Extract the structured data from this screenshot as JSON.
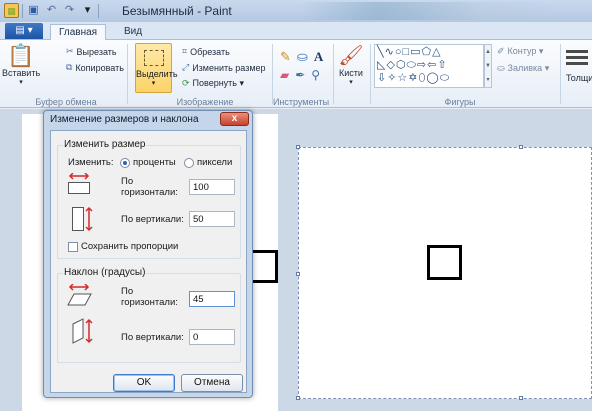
{
  "titlebar": {
    "title": "Безымянный - Paint"
  },
  "ribbon": {
    "file_tab": "▤ ▾",
    "tabs": [
      "Главная",
      "Вид"
    ],
    "clipboard": {
      "paste": "Вставить",
      "cut": "Вырезать",
      "copy": "Копировать",
      "group": "Буфер обмена"
    },
    "image": {
      "select": "Выделить",
      "crop": "Обрезать",
      "resize": "Изменить размер",
      "rotate": "Повернуть ▾",
      "group": "Изображение"
    },
    "tools": {
      "group": "Инструменты"
    },
    "brushes": {
      "label": "Кисти"
    },
    "shapes": {
      "outline": "Контур ▾",
      "fill": "Заливка ▾",
      "group": "Фигуры",
      "glyphs": "╲∿○□▭⬠△\n◺◇⬡⬭⇨⇦⇧\n⇩✧☆✡⬯◯⬭"
    },
    "thickness": "Толщин"
  },
  "dialog": {
    "title": "Изменение размеров и наклона",
    "close": "x",
    "resize": {
      "legend": "Изменить размер",
      "by_label": "Изменить:",
      "percent": "проценты",
      "pixels": "пиксели",
      "horizontal_label_1": "По",
      "horizontal_label_2": "горизонтали:",
      "horizontal_value": "100",
      "vertical_label": "По вертикали:",
      "vertical_value": "50",
      "keep_ratio": "Сохранить пропорции"
    },
    "skew": {
      "legend": "Наклон (градусы)",
      "horizontal_label_1": "По",
      "horizontal_label_2": "горизонтали:",
      "horizontal_value": "45",
      "vertical_label": "По вертикали:",
      "vertical_value": "0"
    },
    "ok": "OK",
    "cancel": "Отмена"
  }
}
